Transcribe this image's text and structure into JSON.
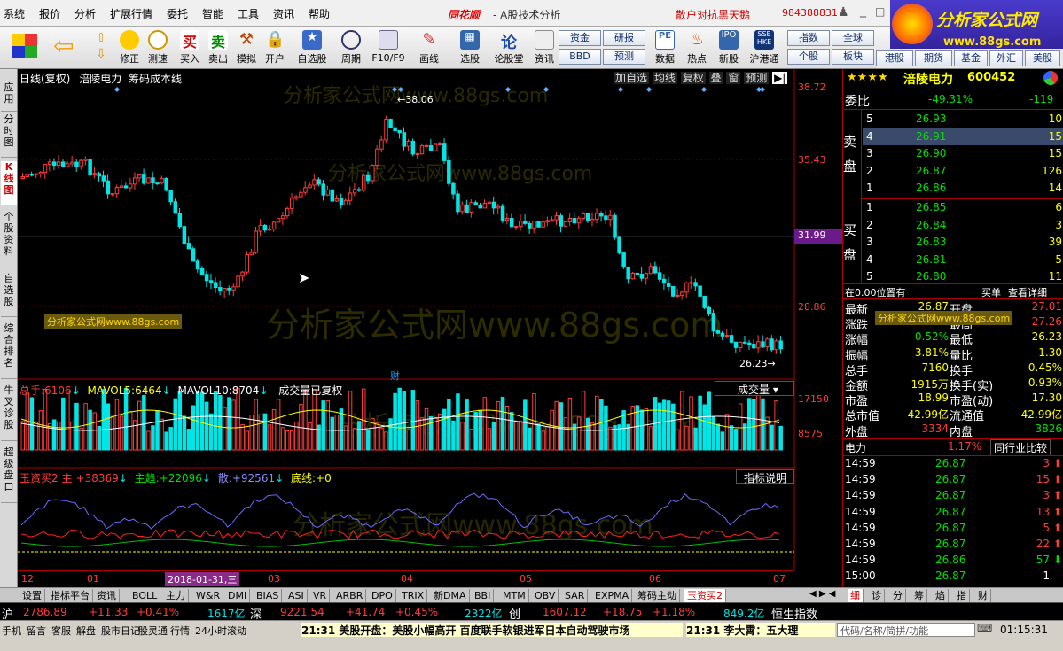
{
  "menu": {
    "items": [
      "系统",
      "报价",
      "分析",
      "扩展行情",
      "委托",
      "智能",
      "工具",
      "资讯",
      "帮助"
    ],
    "brand": "同花顺",
    "subtitle": "- A股技术分析",
    "user": "散户对抗黑天鹅",
    "account": "984388831"
  },
  "logo": {
    "text": "分析家公式网",
    "url": "www.88gs.com"
  },
  "toolbar": {
    "buttons": [
      "修正",
      "测速",
      "买入",
      "卖出",
      "模拟",
      "开户",
      "自选股",
      "周期",
      "F10/F9",
      "画线",
      "选股",
      "论股堂",
      "资讯",
      "数据",
      "热点",
      "新股",
      "沪港通"
    ],
    "right_top": [
      "资金",
      "研报",
      "指数",
      "全球",
      "港股"
    ],
    "right_bottom": [
      "BBD",
      "预测",
      "个股",
      "板块",
      "期货",
      "基金",
      "外汇",
      "美股"
    ]
  },
  "sidetabs": [
    "应用",
    "分时图",
    "K线图",
    "个股资料",
    "自选股",
    "综合排名",
    "牛叉诊股",
    "超级盘口"
  ],
  "chart": {
    "header": "日线(复权)",
    "stock": "涪陵电力",
    "indicator": "筹码成本线",
    "tools": [
      "加自选",
      "均线",
      "复权",
      "叠",
      "窗",
      "预测"
    ],
    "watermark": "分析家公式网www.88gs.com",
    "watermark_label": "分析家公式网www.88gs.com",
    "price_ticks": [
      "38.72",
      "35.43",
      "31.99",
      "28.86"
    ],
    "current_price_tag": "31.99",
    "high_label": "38.06",
    "low_label": "26.23",
    "cai_label": "财",
    "vol_header": {
      "label": "总手:",
      "value": "6106",
      "ma5_label": "MAVOL5:",
      "ma5": "6464",
      "ma10_label": "MAVOL10:",
      "ma10": "8704",
      "note": "成交量已复权",
      "dropdown": "成交量"
    },
    "vol_ticks": [
      "17150",
      "8575"
    ],
    "ind_header": {
      "name": "玉资买2",
      "main_label": "主:",
      "main": "+38369",
      "trend_label": "主趋:",
      "trend": "+22096",
      "sparse_label": "散:",
      "sparse": "+92561",
      "bottom_label": "底线:",
      "bottom": "+0",
      "help": "指标说明"
    },
    "dates": [
      "12",
      "01",
      "03",
      "04",
      "05",
      "06",
      "07"
    ],
    "date_tag": "2018-01-31,三"
  },
  "quote": {
    "stars": "★★★★",
    "name": "涪陵电力",
    "code": "600452",
    "weibi_label": "委比",
    "weibi": "-49.31%",
    "weicha": "-119",
    "sell_label": "卖盘",
    "buy_label": "买盘",
    "sells": [
      {
        "lv": "5",
        "p": "26.93",
        "v": "10"
      },
      {
        "lv": "4",
        "p": "26.91",
        "v": "15"
      },
      {
        "lv": "3",
        "p": "26.90",
        "v": "15"
      },
      {
        "lv": "2",
        "p": "26.87",
        "v": "126"
      },
      {
        "lv": "1",
        "p": "26.86",
        "v": "14"
      }
    ],
    "buys": [
      {
        "lv": "1",
        "p": "26.85",
        "v": "6"
      },
      {
        "lv": "2",
        "p": "26.84",
        "v": "3"
      },
      {
        "lv": "3",
        "p": "26.83",
        "v": "39"
      },
      {
        "lv": "4",
        "p": "26.81",
        "v": "5"
      },
      {
        "lv": "5",
        "p": "26.80",
        "v": "11"
      }
    ],
    "pos_text": "在0.00位置有",
    "buy_single": "买单",
    "detail": "查看详细",
    "stats": [
      [
        "最新",
        "26.87",
        "开盘",
        "27.01"
      ],
      [
        "涨跌",
        "0.14",
        "最高",
        "27.26"
      ],
      [
        "涨幅",
        "-0.52%",
        "最低",
        "26.23"
      ],
      [
        "振幅",
        "3.81%",
        "量比",
        "1.30"
      ],
      [
        "总手",
        "7160",
        "换手",
        "0.45%"
      ],
      [
        "金额",
        "1915万",
        "换手(实)",
        "0.93%"
      ],
      [
        "市盈",
        "18.99",
        "市盈(动)",
        "17.30"
      ],
      [
        "总市值",
        "42.99亿",
        "流通值",
        "42.99亿"
      ],
      [
        "外盘",
        "3334",
        "内盘",
        "3826"
      ]
    ],
    "ind_name": "电力",
    "ind_pct": "1.17%",
    "ind_compare": "同行业比较",
    "ticks": [
      [
        "14:59",
        "26.87",
        "3"
      ],
      [
        "14:59",
        "26.87",
        "15"
      ],
      [
        "14:59",
        "26.87",
        "3"
      ],
      [
        "14:59",
        "26.87",
        "13"
      ],
      [
        "14:59",
        "26.87",
        "5"
      ],
      [
        "14:59",
        "26.87",
        "22"
      ],
      [
        "14:59",
        "26.86",
        "57"
      ],
      [
        "15:00",
        "26.87",
        "1"
      ]
    ],
    "bottom_tabs": [
      "细",
      "诊",
      "分",
      "筹",
      "焰",
      "指",
      "财"
    ]
  },
  "bottomtabs": [
    "设置",
    "指标平台",
    "资讯",
    "BOLL",
    "主力",
    "W&R",
    "DMI",
    "BIAS",
    "ASI",
    "VR",
    "ARBR",
    "DPO",
    "TRIX",
    "新DMA",
    "BBI",
    "MTM",
    "OBV",
    "SAR",
    "EXPMA",
    "筹码主动",
    "玉资买2"
  ],
  "indexbar": {
    "sh": "沪",
    "sh_val": "2786.89",
    "sh_chg": "+11.33",
    "sh_pct": "+0.41%",
    "sh_amt": "1617亿",
    "sz": "深",
    "sz_val": "9221.54",
    "sz_chg": "+41.74",
    "sz_pct": "+0.45%",
    "sz_amt": "2322亿",
    "cy": "创",
    "cy_val": "1607.12",
    "cy_chg": "+18.75",
    "cy_pct": "+1.18%",
    "hk_amt": "849.2亿",
    "hk": "恒生指数"
  },
  "statusbar": {
    "items": [
      "手机",
      "留言",
      "客服",
      "解盘",
      "股市日记",
      "股灵通",
      "行情",
      "24小时滚动"
    ],
    "news1": "21:31 美股开盘：美股小幅高开 百度联手软银进军日本自动驾驶市场",
    "news2": "21:31 李大霄：五大理",
    "search": "代码/名称/简拼/功能",
    "time": "01:15:31"
  }
}
